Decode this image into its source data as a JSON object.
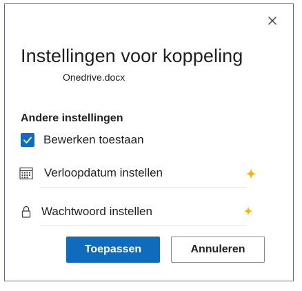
{
  "dialog": {
    "title": "Instellingen voor koppeling",
    "filename": "Onedrive.docx",
    "close_icon": "close-icon"
  },
  "other_settings": {
    "heading": "Andere instellingen",
    "allow_editing": {
      "label": "Bewerken toestaan",
      "checked": true
    },
    "expiration": {
      "label": "Verloopdatum instellen",
      "icon": "calendar-icon",
      "badge_icon": "sparkle-icon"
    },
    "password": {
      "label": "Wachtwoord instellen",
      "icon": "lock-icon",
      "badge_icon": "sparkle-icon"
    }
  },
  "actions": {
    "apply_label": "Toepassen",
    "cancel_label": "Annuleren"
  },
  "colors": {
    "accent": "#0f6cbd",
    "sparkle": "#f7b500",
    "border": "#5d6b8c"
  }
}
